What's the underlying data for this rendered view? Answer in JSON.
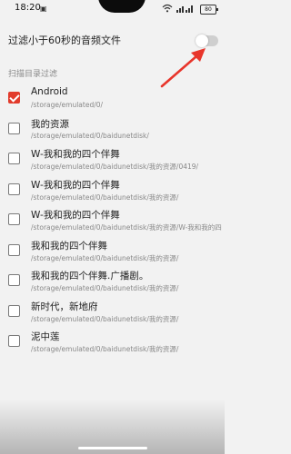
{
  "status_bar": {
    "time": "18:20",
    "battery": "80",
    "icons": [
      "notification-icon",
      "wifi-icon",
      "signal-icon",
      "battery-icon"
    ]
  },
  "filter": {
    "label": "过滤小于60秒的音频文件",
    "toggle_on": false
  },
  "section": {
    "title": "扫描目录过滤"
  },
  "items": [
    {
      "name": "Android",
      "path": "/storage/emulated/0/",
      "checked": true
    },
    {
      "name": "我的资源",
      "path": "/storage/emulated/0/baidunetdisk/",
      "checked": false
    },
    {
      "name": "W-我和我的四个伴舞",
      "path": "/storage/emulated/0/baidunetdisk/我的资源/0419/",
      "checked": false
    },
    {
      "name": "W-我和我的四个伴舞",
      "path": "/storage/emulated/0/baidunetdisk/我的资源/",
      "checked": false
    },
    {
      "name": "W-我和我的四个伴舞",
      "path": "/storage/emulated/0/baidunetdisk/我的资源/W-我和我的四",
      "checked": false
    },
    {
      "name": "我和我的四个伴舞",
      "path": "/storage/emulated/0/baidunetdisk/我的资源/",
      "checked": false
    },
    {
      "name": "我和我的四个伴舞.广播剧。",
      "path": "/storage/emulated/0/baidunetdisk/我的资源/",
      "checked": false
    },
    {
      "name": "新时代，新地府",
      "path": "/storage/emulated/0/baidunetdisk/我的资源/",
      "checked": false
    },
    {
      "name": "泥中莲",
      "path": "/storage/emulated/0/baidunetdisk/我的资源/",
      "checked": false
    }
  ],
  "colors": {
    "accent": "#e23b2c",
    "background": "#f2f2f2"
  }
}
